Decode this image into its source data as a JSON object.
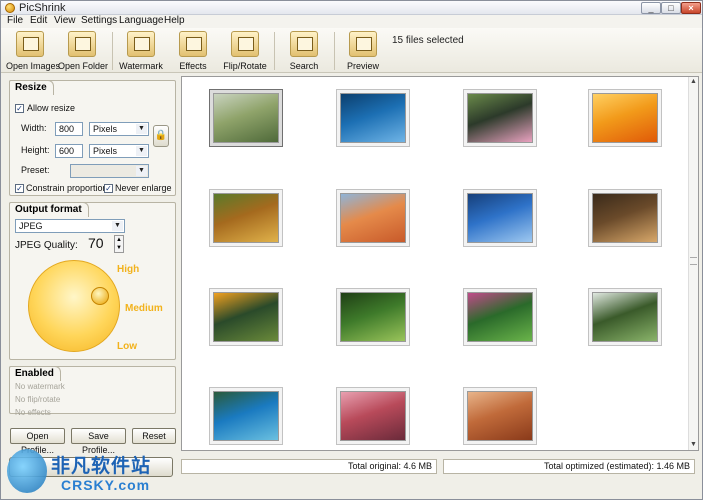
{
  "window": {
    "title": "PicShrink"
  },
  "menu": [
    "File",
    "Edit",
    "View",
    "Settings",
    "Language",
    "Help"
  ],
  "toolbar": {
    "buttons": [
      {
        "label": "Open Images",
        "icon": "open-images-icon"
      },
      {
        "label": "Open Folder",
        "icon": "open-folder-icon"
      },
      {
        "label": "Watermark",
        "icon": "watermark-icon"
      },
      {
        "label": "Effects",
        "icon": "effects-icon"
      },
      {
        "label": "Flip/Rotate",
        "icon": "flip-rotate-icon"
      },
      {
        "label": "Search",
        "icon": "search-icon"
      },
      {
        "label": "Preview",
        "icon": "preview-icon"
      }
    ],
    "status": "15 files selected"
  },
  "resize": {
    "title": "Resize",
    "allow_resize": "Allow resize",
    "width_label": "Width:",
    "width_value": "800",
    "width_unit": "Pixels",
    "height_label": "Height:",
    "height_value": "600",
    "height_unit": "Pixels",
    "preset_label": "Preset:",
    "preset_value": "",
    "constrain": "Constrain proportions",
    "never_enlarge": "Never enlarge"
  },
  "output": {
    "title": "Output format",
    "format": "JPEG",
    "quality_label": "JPEG Quality:",
    "quality_value": "70",
    "dial_high": "High",
    "dial_medium": "Medium",
    "dial_low": "Low"
  },
  "enabled": {
    "title": "Enabled",
    "items": [
      "No watermark",
      "No flip/rotate",
      "No effects"
    ]
  },
  "profile_buttons": {
    "open": "Open Profile...",
    "save": "Save Profile...",
    "reset": "Reset"
  },
  "status": {
    "total_original": "Total original: 4.6 MB",
    "total_optimized": "Total optimized (estimated): 1.46 MB"
  },
  "thumbnails": [
    {
      "subject": "river landscape",
      "colors": [
        "#8fa36a",
        "#4f6a3a",
        "#c9d3c0"
      ]
    },
    {
      "subject": "whale tail",
      "colors": [
        "#1c6fb3",
        "#6fb4e6",
        "#0c3f6e"
      ]
    },
    {
      "subject": "pink flowers",
      "colors": [
        "#2c3a2a",
        "#e9a2c0",
        "#6a8a4a"
      ]
    },
    {
      "subject": "orange flowers",
      "colors": [
        "#f29a1a",
        "#e05a08",
        "#ffd062"
      ]
    },
    {
      "subject": "autumn tree",
      "colors": [
        "#a56a1e",
        "#e0b24a",
        "#5a7a2a"
      ]
    },
    {
      "subject": "desert dunes",
      "colors": [
        "#e58a4a",
        "#c85a2a",
        "#8fb4d8"
      ]
    },
    {
      "subject": "blue lake",
      "colors": [
        "#2e72c8",
        "#9ec8f0",
        "#163f7a"
      ]
    },
    {
      "subject": "lone tree",
      "colors": [
        "#6a4a2a",
        "#d8a86a",
        "#3a2a1a"
      ]
    },
    {
      "subject": "toucan",
      "colors": [
        "#2a4a2a",
        "#6a8a3a",
        "#f0a020"
      ]
    },
    {
      "subject": "forest path",
      "colors": [
        "#3e7a2a",
        "#9ac45a",
        "#1f3f15"
      ]
    },
    {
      "subject": "green leaves",
      "colors": [
        "#2a6a2a",
        "#6ab44a",
        "#c04a8a"
      ]
    },
    {
      "subject": "waterfall",
      "colors": [
        "#3a5a2a",
        "#8ab46a",
        "#e0e8e0"
      ]
    },
    {
      "subject": "sea turtle",
      "colors": [
        "#1a7ac0",
        "#6ac0e0",
        "#2a5a3a"
      ]
    },
    {
      "subject": "tropical flowers",
      "colors": [
        "#b84a5a",
        "#6a2a3a",
        "#e8a0b0"
      ]
    },
    {
      "subject": "monument valley",
      "colors": [
        "#c06a3a",
        "#8a3a1a",
        "#e8b48a"
      ]
    }
  ],
  "watermark": {
    "cn": "非凡软件站",
    "en": "CRSKY.com"
  }
}
